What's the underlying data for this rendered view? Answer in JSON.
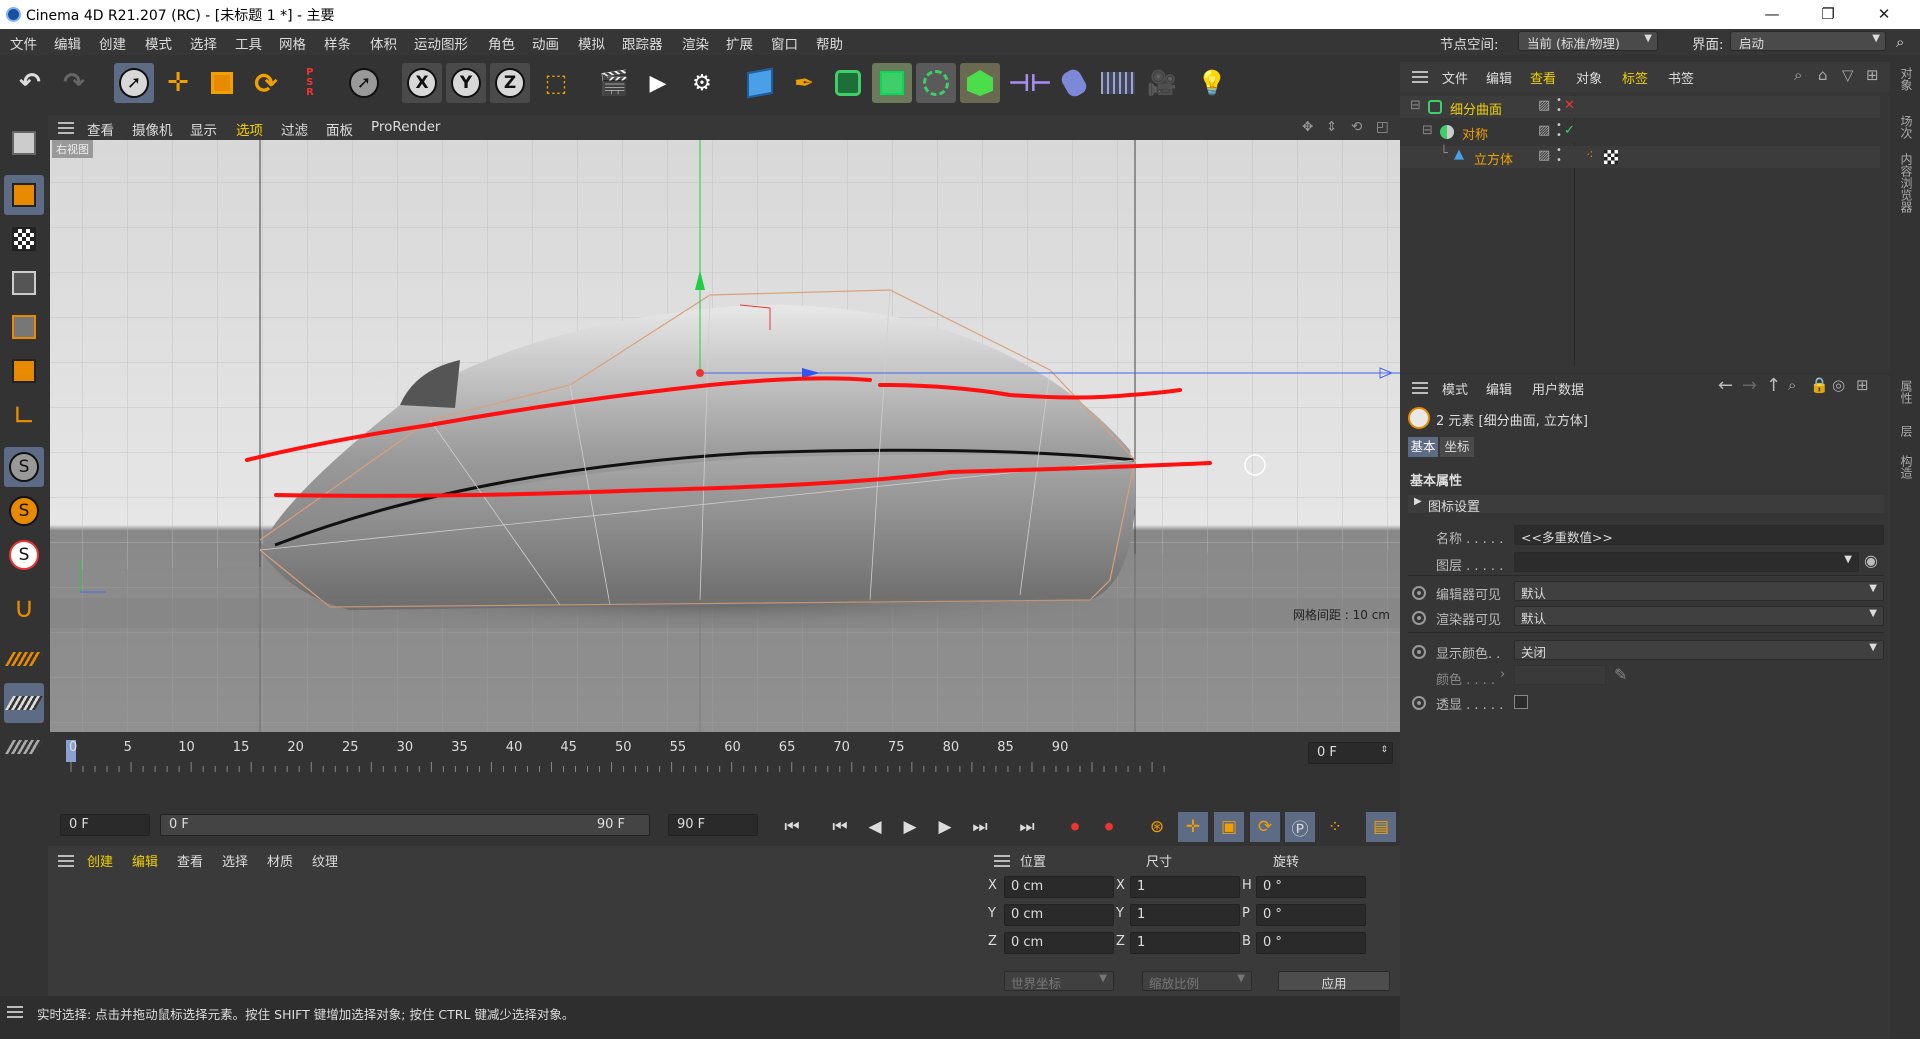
{
  "window": {
    "title": "Cinema 4D R21.207 (RC) - [未标题 1 *] - 主要",
    "minimize": "—",
    "maximize": "❐",
    "close": "✕"
  },
  "menu": [
    "文件",
    "编辑",
    "创建",
    "模式",
    "选择",
    "工具",
    "网格",
    "样条",
    "体积",
    "运动图形",
    "角色",
    "动画",
    "模拟",
    "跟踪器",
    "渲染",
    "扩展",
    "窗口",
    "帮助"
  ],
  "nodespace": {
    "label": "节点空间:",
    "value": "当前 (标准/物理)"
  },
  "layout": {
    "label": "界面:",
    "value": "启动"
  },
  "viewport": {
    "menu": [
      "查看",
      "摄像机",
      "显示",
      "选项",
      "过滤",
      "面板",
      "ProRender"
    ],
    "active_menu": "选项",
    "view_name": "右视图",
    "grid_info": "网格间距 : 10 cm"
  },
  "timeline": {
    "ticks": [
      "0",
      "5",
      "10",
      "15",
      "20",
      "25",
      "30",
      "35",
      "40",
      "45",
      "50",
      "55",
      "60",
      "65",
      "70",
      "75",
      "80",
      "85",
      "90"
    ],
    "current": "0 F"
  },
  "playback": {
    "start": "0 F",
    "range_start": "0 F",
    "range_end": "90 F",
    "end": "90 F"
  },
  "materials": {
    "menu": [
      "创建",
      "编辑",
      "查看",
      "选择",
      "材质",
      "纹理"
    ]
  },
  "coords": {
    "headers": [
      "位置",
      "尺寸",
      "旋转"
    ],
    "rows": [
      {
        "axis": "X",
        "pos": "0 cm",
        "saxis": "X",
        "size": "1",
        "raxis": "H",
        "rot": "0 °"
      },
      {
        "axis": "Y",
        "pos": "0 cm",
        "saxis": "Y",
        "size": "1",
        "raxis": "P",
        "rot": "0 °"
      },
      {
        "axis": "Z",
        "pos": "0 cm",
        "saxis": "Z",
        "size": "1",
        "raxis": "B",
        "rot": "0 °"
      }
    ],
    "mode1": "世界坐标",
    "mode2": "缩放比例",
    "apply": "应用"
  },
  "status": "实时选择: 点击并拖动鼠标选择元素。按住 SHIFT 键增加选择对象; 按住 CTRL 键减少选择对象。",
  "objects": {
    "menu": [
      "文件",
      "编辑",
      "查看",
      "对象",
      "标签",
      "书签"
    ],
    "items": [
      {
        "name": "细分曲面",
        "color": "#f0d000"
      },
      {
        "name": "对称",
        "color": "#f0a000"
      },
      {
        "name": "立方体",
        "color": "#f0a000"
      }
    ]
  },
  "attributes": {
    "menu": [
      "模式",
      "编辑",
      "用户数据"
    ],
    "summary": "2 元素 [细分曲面, 立方体]",
    "tabs": [
      "基本",
      "坐标"
    ],
    "section": "基本属性",
    "group": "图标设置",
    "fields": {
      "name_label": "名称 . . . . .",
      "name_value": "<<多重数值>>",
      "layer_label": "图层 . . . . .",
      "editor_label": "编辑器可见",
      "editor_value": "默认",
      "render_label": "渲染器可见",
      "render_value": "默认",
      "dispcolor_label": "显示颜色. .",
      "dispcolor_value": "关闭",
      "color_label": "颜色 . . . .",
      "xray_label": "透显 . . . . ."
    }
  },
  "right_tabs": [
    "对象",
    "场次",
    "内容浏览器",
    "属性",
    "层",
    "构造"
  ],
  "colors": {
    "accent": "#5d6b85",
    "highlight": "#f0d000",
    "sketch": "#ff1010"
  }
}
